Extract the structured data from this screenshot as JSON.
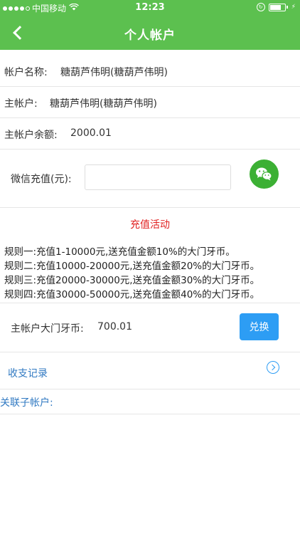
{
  "status_bar": {
    "carrier": "中国移动",
    "time": "12:23"
  },
  "header": {
    "title": "个人帐户"
  },
  "account": {
    "name_label": "帐户名称:",
    "name_value": "糖葫芦伟明(糖葫芦伟明)",
    "main_label": "主帐户:",
    "main_value": "糖葫芦伟明(糖葫芦伟明)",
    "balance_label": "主帐户余额:",
    "balance_value": "2000.01"
  },
  "recharge": {
    "label": "微信充值(元):",
    "input_value": "",
    "input_placeholder": ""
  },
  "activity": {
    "title": "充值活动",
    "rules": [
      "规则一:充值1-10000元,送充值金额10%的大门牙币。",
      "规则二:充值10000-20000元,送充值金额20%的大门牙币。",
      "规则三:充值20000-30000元,送充值金额30%的大门牙币。",
      "规则四:充值30000-50000元,送充值金额40%的大门牙币。"
    ]
  },
  "coins": {
    "label": "主帐户大门牙币:",
    "value": "700.01",
    "exchange_label": "兑换"
  },
  "links": {
    "records_label": "收支记录",
    "sub_accounts_label": "关联子帐户:"
  },
  "colors": {
    "brand_green": "#5cc04f",
    "wechat_green": "#3cb034",
    "accent_blue": "#2d9df4",
    "link_blue": "#3079c2",
    "activity_red": "#e02020"
  },
  "icons": {
    "back": "chevron-left-icon",
    "wechat": "wechat-icon",
    "records_arrow": "circle-chevron-right-icon"
  }
}
